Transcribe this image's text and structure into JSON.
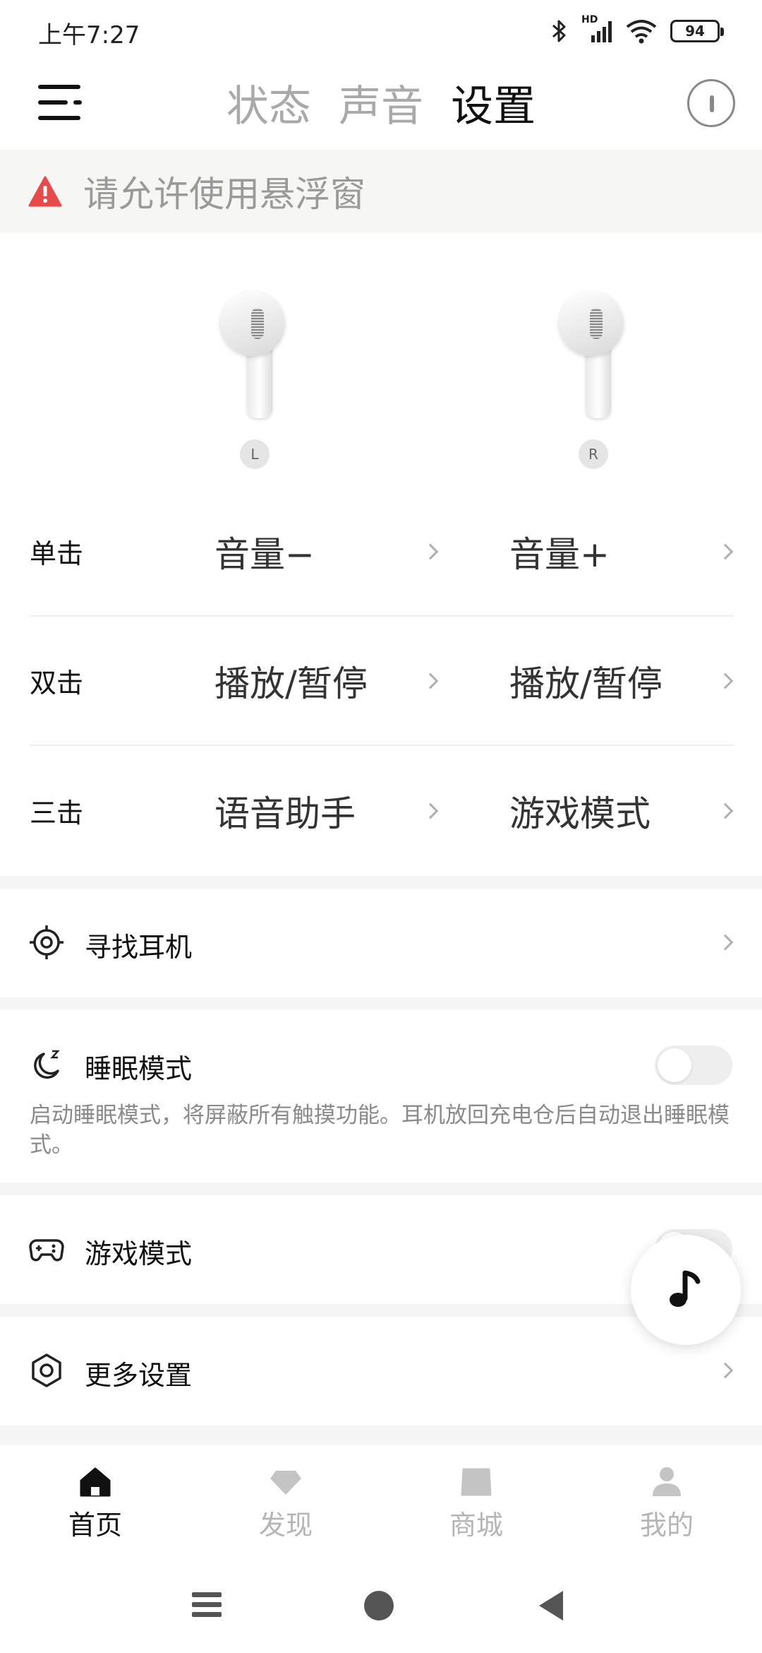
{
  "status_bar": {
    "time": "上午7:27",
    "battery": "94",
    "network_label": "HD",
    "icons": [
      "bluetooth-icon",
      "signal-icon",
      "wifi-icon",
      "battery-icon"
    ]
  },
  "header": {
    "tabs": [
      {
        "label": "状态",
        "active": false
      },
      {
        "label": "声音",
        "active": false
      },
      {
        "label": "设置",
        "active": true
      }
    ]
  },
  "banner": {
    "text": "请允许使用悬浮窗",
    "icon": "warning-icon",
    "icon_color": "#e84a4a"
  },
  "earbuds": {
    "left_label": "L",
    "right_label": "R"
  },
  "gestures": [
    {
      "label": "单击",
      "left": "音量−",
      "right": "音量+"
    },
    {
      "label": "双击",
      "left": "播放/暂停",
      "right": "播放/暂停"
    },
    {
      "label": "三击",
      "left": "语音助手",
      "right": "游戏模式"
    }
  ],
  "settings": {
    "find": {
      "label": "寻找耳机",
      "icon": "target-icon"
    },
    "sleep": {
      "label": "睡眠模式",
      "icon": "moon-icon",
      "enabled": false,
      "description": "启动睡眠模式，将屏蔽所有触摸功能。耳机放回充电仓后自动退出睡眠模式。"
    },
    "game": {
      "label": "游戏模式",
      "icon": "gamepad-icon",
      "enabled": false
    },
    "more": {
      "label": "更多设置",
      "icon": "hex-nut-icon"
    }
  },
  "floating": {
    "icon": "music-note-icon"
  },
  "bottom_nav": [
    {
      "label": "首页",
      "icon": "home-icon",
      "active": true
    },
    {
      "label": "发现",
      "icon": "diamond-icon",
      "active": false
    },
    {
      "label": "商城",
      "icon": "bag-icon",
      "active": false
    },
    {
      "label": "我的",
      "icon": "person-icon",
      "active": false
    }
  ],
  "colors": {
    "active_text": "#111111",
    "inactive_text": "#a9a9a9",
    "banner_bg": "#f6f6f4",
    "separator": "#f5f5f5"
  }
}
